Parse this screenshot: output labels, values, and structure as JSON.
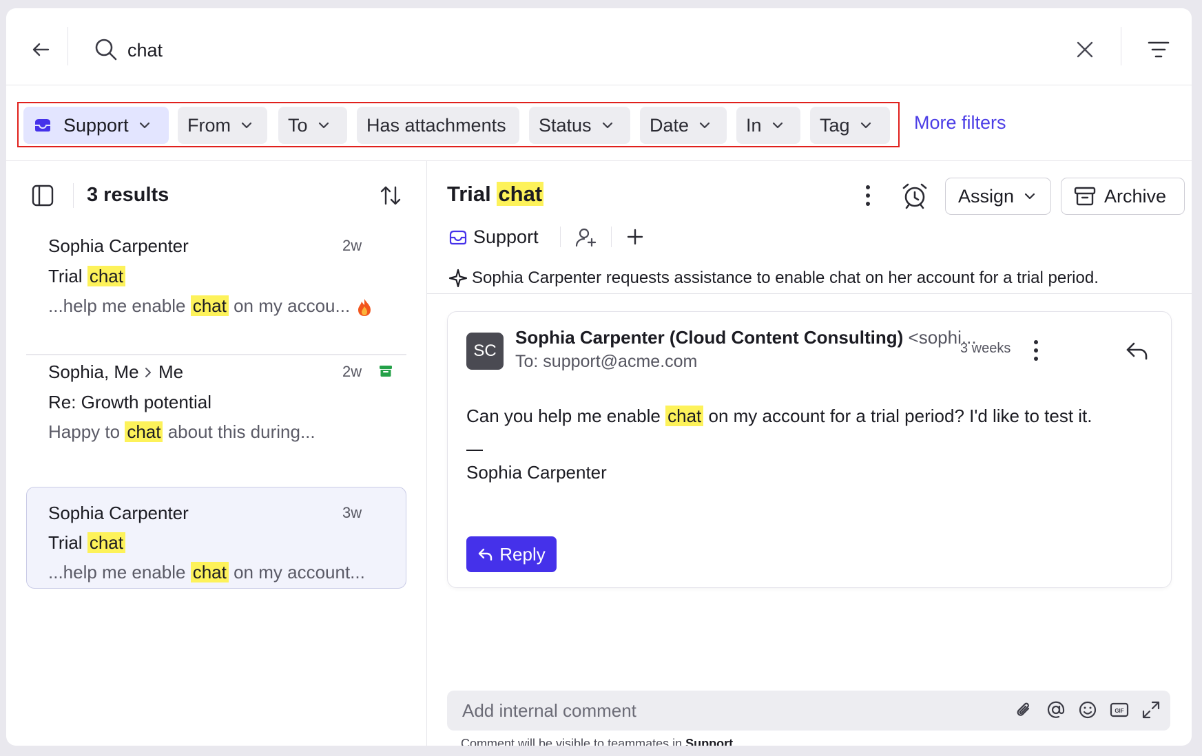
{
  "search": {
    "value": "chat"
  },
  "filters": {
    "chips": [
      "Support",
      "From",
      "To",
      "Has attachments",
      "Status",
      "Date",
      "In",
      "Tag"
    ],
    "more_filters": "More filters"
  },
  "list": {
    "results_count": "3 results",
    "items": [
      {
        "sender": "Sophia Carpenter",
        "time": "2w",
        "subject_pre": "Trial",
        "subject_hl": "chat",
        "snippet_pre": "...help me enable",
        "snippet_hl": "chat",
        "snippet_post": "on my accou...",
        "badge": "fire-icon"
      },
      {
        "sender": "Sophia, Me",
        "sender_to": "Me",
        "time": "2w",
        "subject": "Re: Growth potential",
        "snippet_pre": "Happy to",
        "snippet_hl": "chat",
        "snippet_post": "about this during...",
        "badge": "archive-icon"
      },
      {
        "sender": "Sophia Carpenter",
        "time": "3w",
        "subject_pre": "Trial",
        "subject_hl": "chat",
        "snippet_pre": "...help me enable",
        "snippet_hl": "chat",
        "snippet_post": "on my account..."
      }
    ]
  },
  "conversation": {
    "title_pre": "Trial",
    "title_hl": "chat",
    "assign_label": "Assign",
    "archive_label": "Archive",
    "inbox": "Support",
    "summary": "Sophia Carpenter requests assistance to enable chat on her account for a trial period.",
    "message": {
      "avatar": "SC",
      "from_name": "Sophia Carpenter (Cloud Content Consulting)",
      "from_email": "<sophi...",
      "to": "To: support@acme.com",
      "time": "3 weeks",
      "body_pre": "Can you help me enable",
      "body_hl": "chat",
      "body_post": "on my account for a trial period? I'd like to test it.",
      "signature": "Sophia Carpenter",
      "reply_label": "Reply"
    },
    "comment": {
      "placeholder": "Add internal comment",
      "note_pre": "Comment will be visible to teammates in",
      "note_inbox": "Support"
    }
  },
  "colors": {
    "accent": "#4531ea",
    "link": "#4c3ee6",
    "highlight": "#fdf25a",
    "outline": "#e0201c"
  }
}
